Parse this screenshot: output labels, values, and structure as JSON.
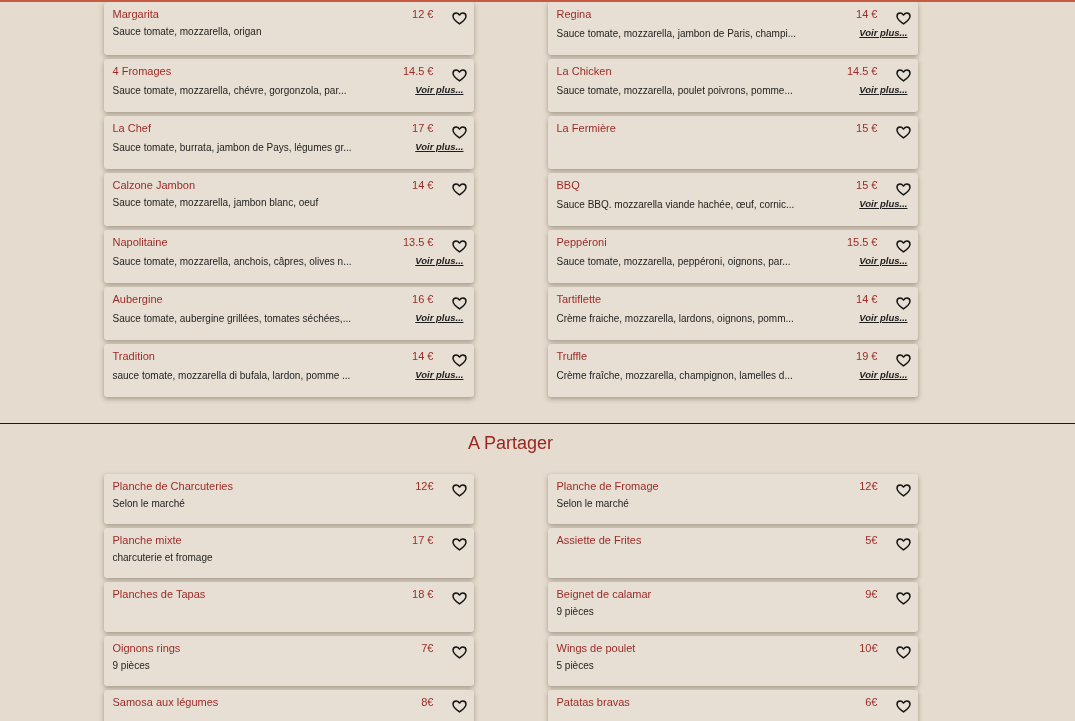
{
  "sections": [
    {
      "items": [
        {
          "name": "Margarita",
          "price": "12 €",
          "description": "Sauce tomate, mozzarella, origan",
          "favorite": false
        },
        {
          "name": "Regina",
          "price": "14 €",
          "description": "Sauce tomate, mozzarella, jambon de Paris, champi...",
          "more_link": "Voir plus...",
          "favorite": false
        },
        {
          "name": "4 Fromages",
          "price": "14.5 €",
          "description": "Sauce tomate, mozzarella, chévre, gorgonzola, par...",
          "more_link": "Voir plus...",
          "favorite": false
        },
        {
          "name": "La Chicken",
          "price": "14.5 €",
          "description": "Sauce tomate, mozzarella, poulet poivrons, pomme...",
          "more_link": "Voir plus...",
          "favorite": false
        },
        {
          "name": "La Chef",
          "price": "17 €",
          "description": "Sauce tomate, burrata, jambon de Pays, légumes gr...",
          "more_link": "Voir plus...",
          "favorite": false
        },
        {
          "name": "La Fermière",
          "price": "15 €",
          "favorite": false
        },
        {
          "name": "Calzone Jambon",
          "price": "14 €",
          "description": "Sauce tomate, mozzarella, jambon blanc, oeuf",
          "favorite": false
        },
        {
          "name": "BBQ",
          "price": "15 €",
          "description": "Sauce BBQ. mozzarella viande hachée, œuf, cornic...",
          "more_link": "Voir plus...",
          "favorite": false
        },
        {
          "name": "Napolitaine",
          "price": "13.5 €",
          "description": "Sauce tomate, mozzarella, anchois, câpres, olives n...",
          "more_link": "Voir plus...",
          "favorite": false
        },
        {
          "name": "Peppéroni",
          "price": "15.5 €",
          "description": "Sauce tomate, mozzarella, peppéroni, oignons, par...",
          "more_link": "Voir plus...",
          "favorite": false
        },
        {
          "name": "Aubergine",
          "price": "16 €",
          "description": "Sauce tomate, aubergine grillées, tomates séchées,...",
          "more_link": "Voir plus...",
          "favorite": false
        },
        {
          "name": "Tartiflette",
          "price": "14 €",
          "description": "Crème fraiche, mozzarella, lardons, oignons, pomm...",
          "more_link": "Voir plus...",
          "favorite": false
        },
        {
          "name": "Tradition",
          "price": "14 €",
          "description": "sauce tomate, mozzarella di bufala, lardon, pomme ...",
          "more_link": "Voir plus...",
          "favorite": false
        },
        {
          "name": "Truffle",
          "price": "19 €",
          "description": "Crème fraîche, mozzarella, champignon, lamelles d...",
          "more_link": "Voir plus...",
          "favorite": false
        }
      ]
    },
    {
      "title": "A Partager",
      "items": [
        {
          "name": "Planche de Charcuteries",
          "price": "12€",
          "description": "Selon le marché",
          "favorite": false
        },
        {
          "name": "Planche de Fromage",
          "price": "12€",
          "description": "Selon le marché",
          "favorite": false
        },
        {
          "name": "Planche mixte",
          "price": "17 €",
          "description": "charcuterie et fromage",
          "favorite": false
        },
        {
          "name": "Assiette de Frites",
          "price": "5€",
          "favorite": false
        },
        {
          "name": "Planches de Tapas",
          "price": "18 €",
          "favorite": false
        },
        {
          "name": "Beignet de calamar",
          "price": "9€",
          "description": "9 pièces",
          "favorite": false
        },
        {
          "name": "Oignons rings",
          "price": "7€",
          "description": "9 pièces",
          "favorite": false
        },
        {
          "name": "Wings de poulet",
          "price": "10€",
          "description": "5 pièces",
          "favorite": false
        },
        {
          "name": "Samosa aux légumes",
          "price": "8€",
          "favorite": false
        },
        {
          "name": "Patatas bravas",
          "price": "6€",
          "favorite": false
        }
      ]
    }
  ]
}
